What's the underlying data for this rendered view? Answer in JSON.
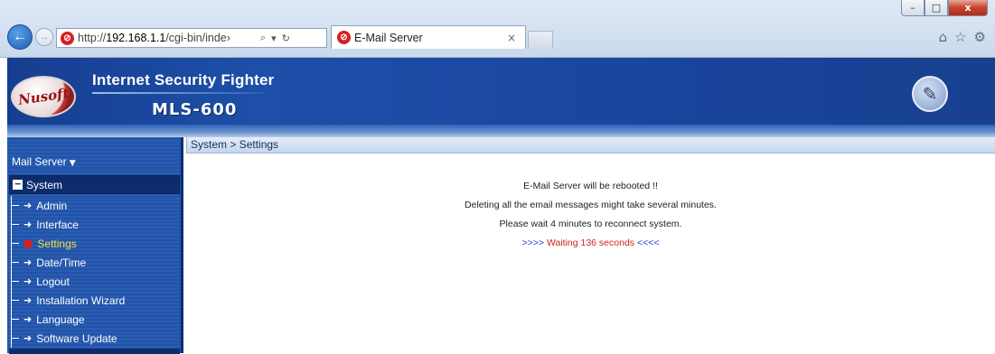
{
  "browser": {
    "window_controls": {
      "minimize": "–",
      "maximize": "□",
      "close": "x"
    },
    "address": {
      "url_prefix": "http://",
      "url_host": "192.168.1.1",
      "url_rest": "/cgi-bin/inde›",
      "search_icon": "⌕",
      "dropdown": "▾",
      "refresh": "↻"
    },
    "tab": {
      "title": "E-Mail Server",
      "close": "×"
    },
    "icons": [
      "home-icon",
      "star-icon",
      "gear-icon"
    ]
  },
  "header": {
    "logo_text": "Nusoft",
    "product_title": "Internet Security Fighter",
    "model": "MLS-600"
  },
  "sidebar": {
    "section_menu": "Mail Server",
    "group": "System",
    "items": [
      {
        "label": "Admin",
        "active": false
      },
      {
        "label": "Interface",
        "active": false
      },
      {
        "label": "Settings",
        "active": true
      },
      {
        "label": "Date/Time",
        "active": false
      },
      {
        "label": "Logout",
        "active": false
      },
      {
        "label": "Installation Wizard",
        "active": false
      },
      {
        "label": "Language",
        "active": false
      },
      {
        "label": "Software Update",
        "active": false
      }
    ]
  },
  "main": {
    "breadcrumb": "System > Settings",
    "messages": [
      "E-Mail Server will be rebooted !!",
      "Deleting all the email messages might take several minutes.",
      "Please wait 4 minutes to reconnect system."
    ],
    "countdown": {
      "prefix": ">>>>",
      "text": "Waiting  136 seconds",
      "suffix": "<<<<"
    }
  },
  "colors": {
    "nav_bg": "#2153a8",
    "header_bg": "#1d4fa8",
    "active_item": "#f2e23a",
    "countdown_red": "#d21f1f",
    "countdown_blue": "#1f3bd1"
  }
}
